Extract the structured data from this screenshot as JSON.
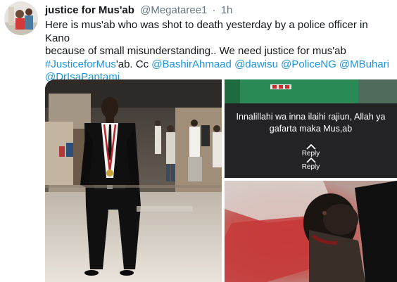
{
  "tweet": {
    "display_name": "justice for Mus'ab",
    "handle": "@Megataree1",
    "separator": "·",
    "time": "1h",
    "text": {
      "line1": "Here is mus'ab who was shot to death yesterday by a police officer in Kano",
      "line2": "because of small misunderstanding.. We need justice for mus'ab",
      "hashtag": "#JusticeforMus",
      "line3_mid": "'ab. Cc ",
      "mentions": [
        "@BashirAhmaad",
        "@dawisu",
        "@PoliceNG",
        "@MBuhari",
        "@DrIsaPantami"
      ]
    }
  },
  "media": {
    "photo2": {
      "caption_line1": "Innalillahi wa inna ilaihi rajiun, Allah ya",
      "caption_line2": "gafarta maka Mus,ab",
      "reply_upper": "Reply",
      "reply_lower": "Reply"
    }
  },
  "colors": {
    "link": "#1b95e0",
    "secondary_text": "#657786",
    "primary_text": "#14171a"
  }
}
